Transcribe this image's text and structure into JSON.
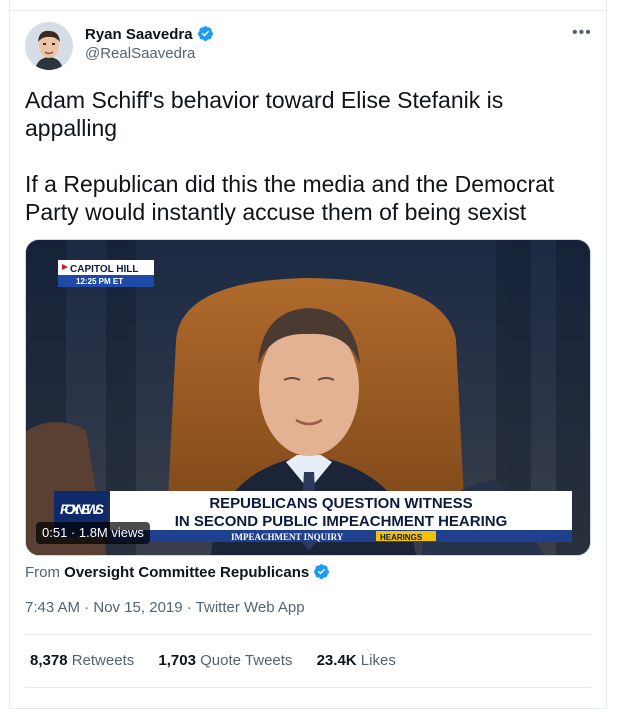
{
  "user": {
    "name": "Ryan Saavedra",
    "handle": "@RealSaavedra",
    "verified": true
  },
  "tweet": {
    "text": "Adam Schiff's behavior toward Elise Stefanik is appalling\n\nIf a Republican did this the media and the Democrat Party would instantly accuse them of being sexist"
  },
  "media": {
    "overlay_badge": "CAPITOL HILL",
    "overlay_time": "12:25 PM ET",
    "network_logo": "FOX NEWS",
    "headline_line1": "REPUBLICANS QUESTION WITNESS",
    "headline_line2": "IN SECOND PUBLIC IMPEACHMENT HEARING",
    "ticker": "IMPEACHMENT INQUIRY",
    "ticker_tag": "HEARINGS",
    "duration_views": "0:51 · 1.8M views"
  },
  "attribution": {
    "prefix": "From",
    "source": "Oversight Committee Republicans"
  },
  "meta": "7:43 AM · Nov 15, 2019 · Twitter Web App",
  "stats": {
    "retweets_count": "8,378",
    "retweets_label": "Retweets",
    "quotes_count": "1,703",
    "quotes_label": "Quote Tweets",
    "likes_count": "23.4K",
    "likes_label": "Likes"
  },
  "colors": {
    "accent": "#1d9bf0",
    "muted": "#536471"
  }
}
